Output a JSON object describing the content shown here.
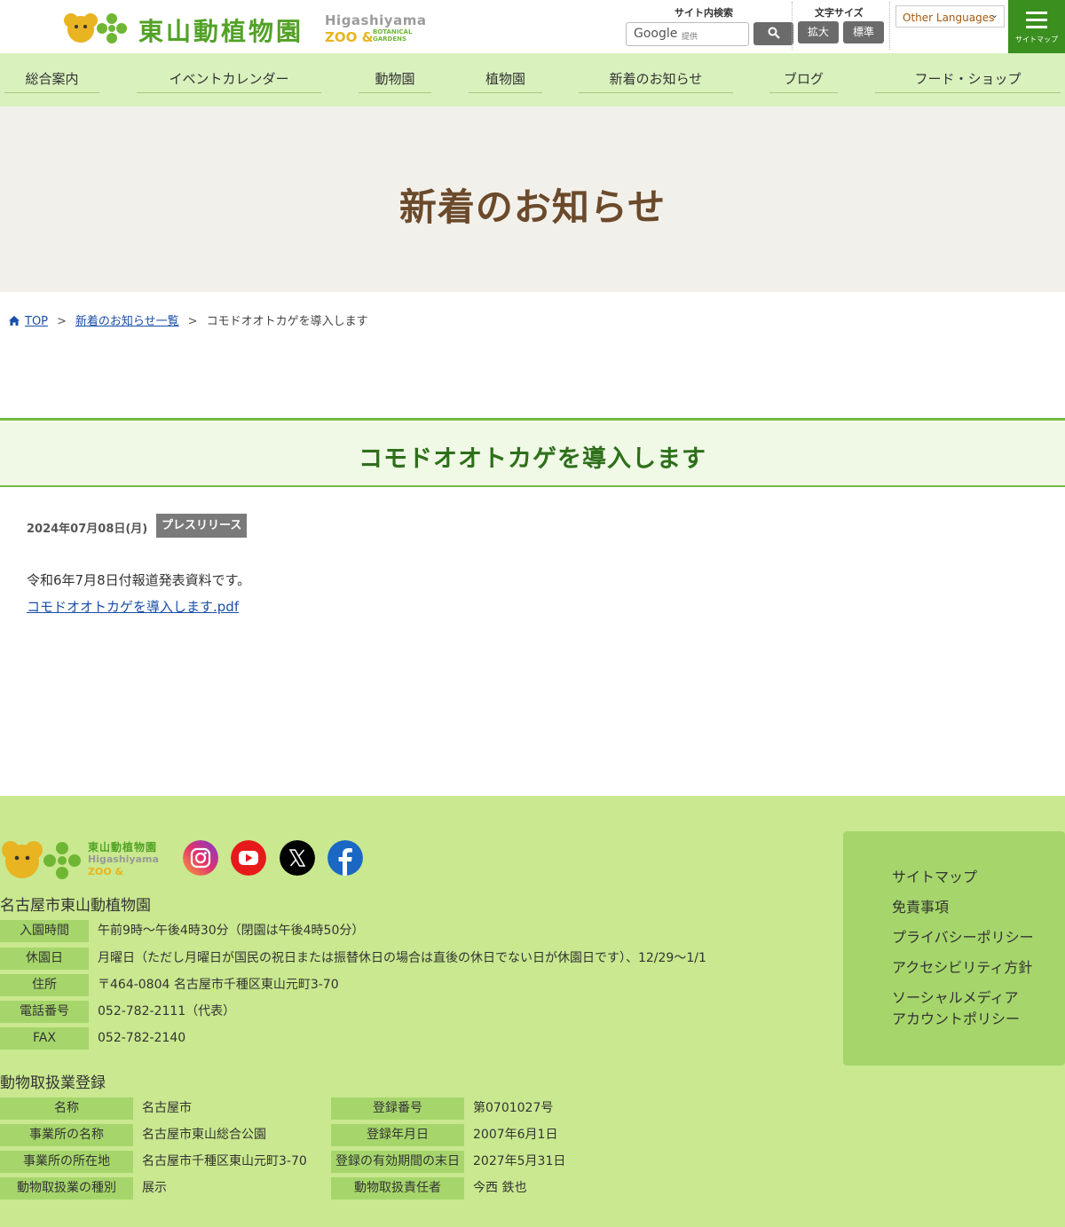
{
  "header": {
    "logo_jp": "東山動植物園",
    "logo_en": "Higashiyama",
    "logo_zoo": "ZOO &",
    "logo_botanical": "BOTANICAL GARDENS",
    "search_label": "サイト内検索",
    "search_google": "Google",
    "search_provided": "提供",
    "font_size_label": "文字サイズ",
    "enlarge_label": "拡大",
    "standard_label": "標準",
    "language_select": "Other Languages",
    "sitemap_label": "サイトマップ",
    "accent_color": "#3a8f1e"
  },
  "nav": {
    "items": [
      {
        "label": "総合案内"
      },
      {
        "label": "イベントカレンダー"
      },
      {
        "label": "動物園"
      },
      {
        "label": "植物園"
      },
      {
        "label": "新着のお知らせ"
      },
      {
        "label": "ブログ"
      },
      {
        "label": "フード・ショップ"
      }
    ]
  },
  "hero": {
    "title": "新着のお知らせ"
  },
  "breadcrumb": {
    "top": "TOP",
    "list": "新着のお知らせ一覧",
    "current": "コモドオオトカゲを導入します",
    "separator": ">"
  },
  "article": {
    "title": "コモドオオトカゲを導入します",
    "date": "2024年07月08日(月)",
    "category": "プレスリリース",
    "body": "令和6年7月8日付報道発表資料です。",
    "pdf_link": "コモドオオトカゲを導入します.pdf"
  },
  "footer": {
    "logo_jp": "東山動植物園",
    "logo_en": "Higashiyama",
    "logo_zoo": "ZOO &",
    "sns": [
      "instagram-icon",
      "youtube-icon",
      "x-icon",
      "facebook-icon"
    ],
    "name": "名古屋市東山動植物園",
    "info": [
      {
        "label": "入園時間",
        "value": "午前9時～午後4時30分（閉園は午後4時50分）"
      },
      {
        "label": "休園日",
        "value": "月曜日（ただし月曜日が国民の祝日または振替休日の場合は直後の休日でない日が休園日です）、12/29～1/1"
      },
      {
        "label": "住所",
        "value": "〒464-0804 名古屋市千種区東山元町3-70"
      },
      {
        "label": "電話番号",
        "value": "052-782-2111（代表）"
      },
      {
        "label": "FAX",
        "value": "052-782-2140"
      }
    ],
    "registration_title": "動物取扱業登録",
    "registration_left": [
      {
        "label": "名称",
        "value": "名古屋市"
      },
      {
        "label": "事業所の名称",
        "value": "名古屋市東山総合公園"
      },
      {
        "label": "事業所の所在地",
        "value": "名古屋市千種区東山元町3-70"
      },
      {
        "label": "動物取扱業の種別",
        "value": "展示"
      }
    ],
    "registration_right": [
      {
        "label": "登録番号",
        "value": "第0701027号"
      },
      {
        "label": "登録年月日",
        "value": "2007年6月1日"
      },
      {
        "label": "登録の有効期間の末日",
        "value": "2027年5月31日"
      },
      {
        "label": "動物取扱責任者",
        "value": "今西 鉄也"
      }
    ],
    "links": [
      {
        "label": "サイトマップ"
      },
      {
        "label": "免責事項"
      },
      {
        "label": "プライバシーポリシー"
      },
      {
        "label": "アクセシビリティ方針"
      },
      {
        "label": "ソーシャルメディア"
      },
      {
        "label": "アカウントポリシー"
      }
    ]
  }
}
